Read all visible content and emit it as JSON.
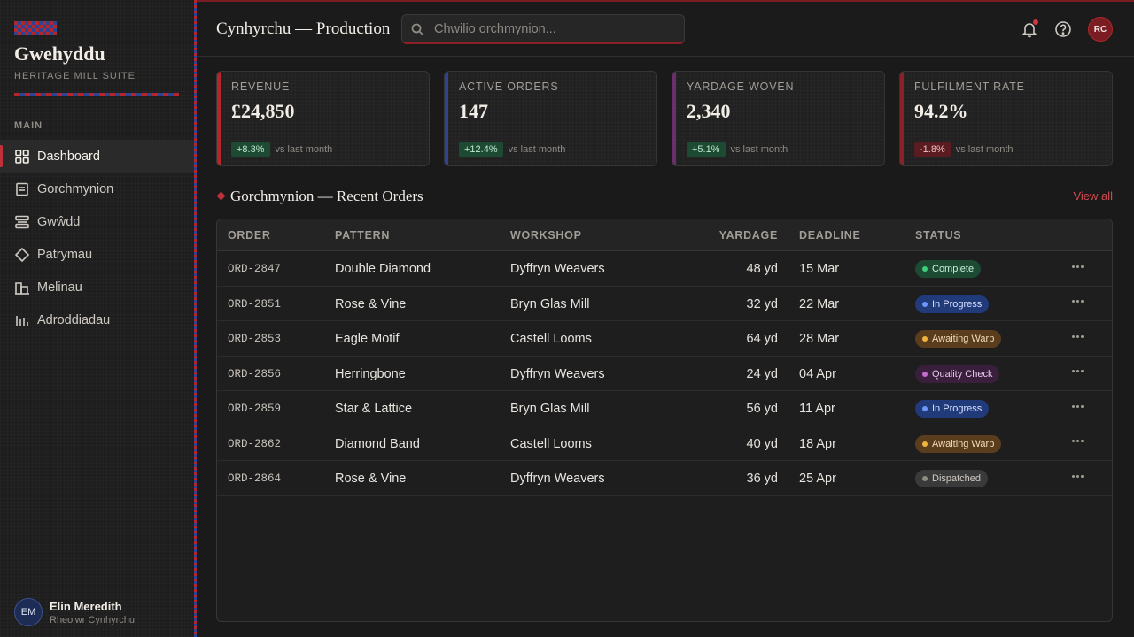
{
  "brand": {
    "name": "Gwehyddu",
    "subtitle": "HERITAGE MILL SUITE"
  },
  "nav": {
    "heading": "MAIN",
    "items": [
      {
        "label": "Dashboard",
        "icon": "grid-icon",
        "active": true
      },
      {
        "label": "Gorchmynion",
        "icon": "document-icon"
      },
      {
        "label": "Gwŵdd",
        "icon": "loom-icon"
      },
      {
        "label": "Patrymau",
        "icon": "diamond-icon"
      },
      {
        "label": "Melinau",
        "icon": "building-icon"
      },
      {
        "label": "Adroddiadau",
        "icon": "bar-chart-icon"
      }
    ]
  },
  "user": {
    "initials": "EM",
    "name": "Elin Meredith",
    "role": "Rheolwr Cynhyrchu"
  },
  "header": {
    "title": "Cynhyrchu — Production",
    "search_placeholder": "Chwilio orchmynion...",
    "avatar_initials": "RC"
  },
  "colors": {
    "accent": "#b3262b",
    "weave_blue": "#2e4391",
    "kpi_accents": [
      "#b3262b",
      "#2e4391",
      "#6b2f6b",
      "#8c2128"
    ]
  },
  "kpis": [
    {
      "label": "REVENUE",
      "value": "£24,850",
      "delta": "+8.3%",
      "trend": "up",
      "compare": "vs last month"
    },
    {
      "label": "ACTIVE ORDERS",
      "value": "147",
      "delta": "+12.4%",
      "trend": "up",
      "compare": "vs last month"
    },
    {
      "label": "YARDAGE WOVEN",
      "value": "2,340",
      "delta": "+5.1%",
      "trend": "up",
      "compare": "vs last month"
    },
    {
      "label": "FULFILMENT RATE",
      "value": "94.2%",
      "delta": "-1.8%",
      "trend": "down",
      "compare": "vs last month"
    }
  ],
  "orders": {
    "title": "Gorchmynion — Recent Orders",
    "view_all": "View all",
    "columns": {
      "order": "ORDER",
      "pattern": "PATTERN",
      "workshop": "WORKSHOP",
      "yardage": "YARDAGE",
      "deadline": "DEADLINE",
      "status": "STATUS"
    },
    "rows": [
      {
        "order": "ORD-2847",
        "pattern": "Double Diamond",
        "workshop": "Dyffryn Weavers",
        "yardage": "48 yd",
        "deadline": "15 Mar",
        "status": "Complete",
        "status_kind": "complete"
      },
      {
        "order": "ORD-2851",
        "pattern": "Rose & Vine",
        "workshop": "Bryn Glas Mill",
        "yardage": "32 yd",
        "deadline": "22 Mar",
        "status": "In Progress",
        "status_kind": "progress"
      },
      {
        "order": "ORD-2853",
        "pattern": "Eagle Motif",
        "workshop": "Castell Looms",
        "yardage": "64 yd",
        "deadline": "28 Mar",
        "status": "Awaiting Warp",
        "status_kind": "awaiting"
      },
      {
        "order": "ORD-2856",
        "pattern": "Herringbone",
        "workshop": "Dyffryn Weavers",
        "yardage": "24 yd",
        "deadline": "04 Apr",
        "status": "Quality Check",
        "status_kind": "quality"
      },
      {
        "order": "ORD-2859",
        "pattern": "Star & Lattice",
        "workshop": "Bryn Glas Mill",
        "yardage": "56 yd",
        "deadline": "11 Apr",
        "status": "In Progress",
        "status_kind": "progress"
      },
      {
        "order": "ORD-2862",
        "pattern": "Diamond Band",
        "workshop": "Castell Looms",
        "yardage": "40 yd",
        "deadline": "18 Apr",
        "status": "Awaiting Warp",
        "status_kind": "awaiting"
      },
      {
        "order": "ORD-2864",
        "pattern": "Rose & Vine",
        "workshop": "Dyffryn Weavers",
        "yardage": "36 yd",
        "deadline": "25 Apr",
        "status": "Dispatched",
        "status_kind": "dispatched"
      }
    ]
  },
  "status_styles": {
    "complete": {
      "bg": "#1d4a33",
      "fg": "#c9f0d8",
      "dot": "#3ecf7d"
    },
    "progress": {
      "bg": "#213a7a",
      "fg": "#d6e0ff",
      "dot": "#6f95ff"
    },
    "awaiting": {
      "bg": "#5a3d1d",
      "fg": "#f3dcb8",
      "dot": "#f0b43c"
    },
    "quality": {
      "bg": "#3a1f3d",
      "fg": "#e8c9ec",
      "dot": "#c46bd0"
    },
    "dispatched": {
      "bg": "#3a3a3a",
      "fg": "#cfcac4",
      "dot": "#8f8a84"
    }
  }
}
